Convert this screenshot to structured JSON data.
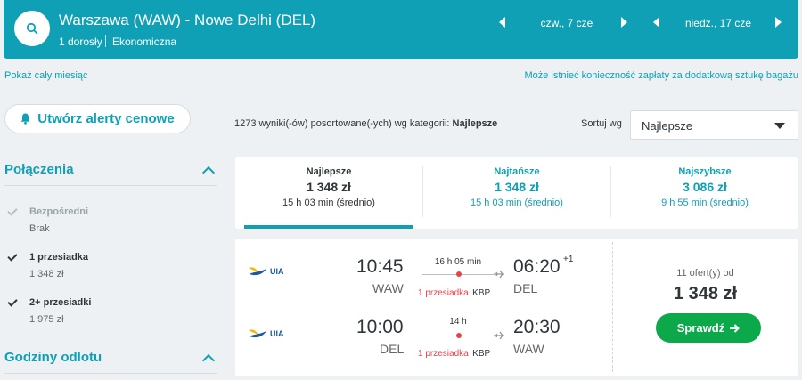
{
  "header": {
    "route": "Warszawa (WAW) - Nowe Delhi (DEL)",
    "passengers": "1 dorosły",
    "cabin_class": "Ekonomiczna",
    "depart_date": "czw., 7 cze",
    "return_date": "niedz., 17 cze"
  },
  "links": {
    "show_month": "Pokaż cały miesiąc",
    "baggage_note": "Może istnieć konieczność zapłaty za dodatkową sztukę bagażu"
  },
  "alert_button": {
    "label": "Utwórz alerty cenowe"
  },
  "results": {
    "count_text": "1273 wyniki(-ów) posortowane(-ych) wg kategorii:",
    "count_category": "Najlepsze"
  },
  "sort": {
    "label": "Sortuj wg",
    "selected": "Najlepsze"
  },
  "sidebar": {
    "connections_title": "Połączenia",
    "filters": [
      {
        "label": "Bezpośredni",
        "sub": "Brak",
        "checked": true,
        "disabled": true
      },
      {
        "label": "1 przesiadka",
        "sub": "1 348 zł",
        "checked": true,
        "disabled": false
      },
      {
        "label": "2+ przesiadki",
        "sub": "1 975 zł",
        "checked": true,
        "disabled": false
      }
    ],
    "departure_title": "Godziny odlotu"
  },
  "tabs": [
    {
      "name": "Najlepsze",
      "price": "1 348 zł",
      "duration": "15 h 03 min (średnio)",
      "active": true
    },
    {
      "name": "Najtańsze",
      "price": "1 348 zł",
      "duration": "15 h 03 min (średnio)",
      "active": false
    },
    {
      "name": "Najszybsze",
      "price": "3 086 zł",
      "duration": "9 h 55 min (średnio)",
      "active": false
    }
  ],
  "result": {
    "legs": [
      {
        "airline": "UIA",
        "dep_time": "10:45",
        "dep_code": "WAW",
        "duration": "16 h 05 min",
        "stops": "1 przesiadka",
        "via": "KBP",
        "arr_time": "06:20",
        "arr_plus": "+1",
        "arr_code": "DEL"
      },
      {
        "airline": "UIA",
        "dep_time": "10:00",
        "dep_code": "DEL",
        "duration": "14 h",
        "stops": "1 przesiadka",
        "via": "KBP",
        "arr_time": "20:30",
        "arr_plus": "",
        "arr_code": "WAW"
      }
    ],
    "offers": "11 ofert(y) od",
    "price": "1 348 zł",
    "check_label": "Sprawdź"
  },
  "colors": {
    "accent": "#0fa0b6",
    "button_green": "#0ca94b",
    "stops_red": "#e8414b",
    "airline_blue": "#1c5aa0",
    "airline_gold": "#f2b705"
  }
}
